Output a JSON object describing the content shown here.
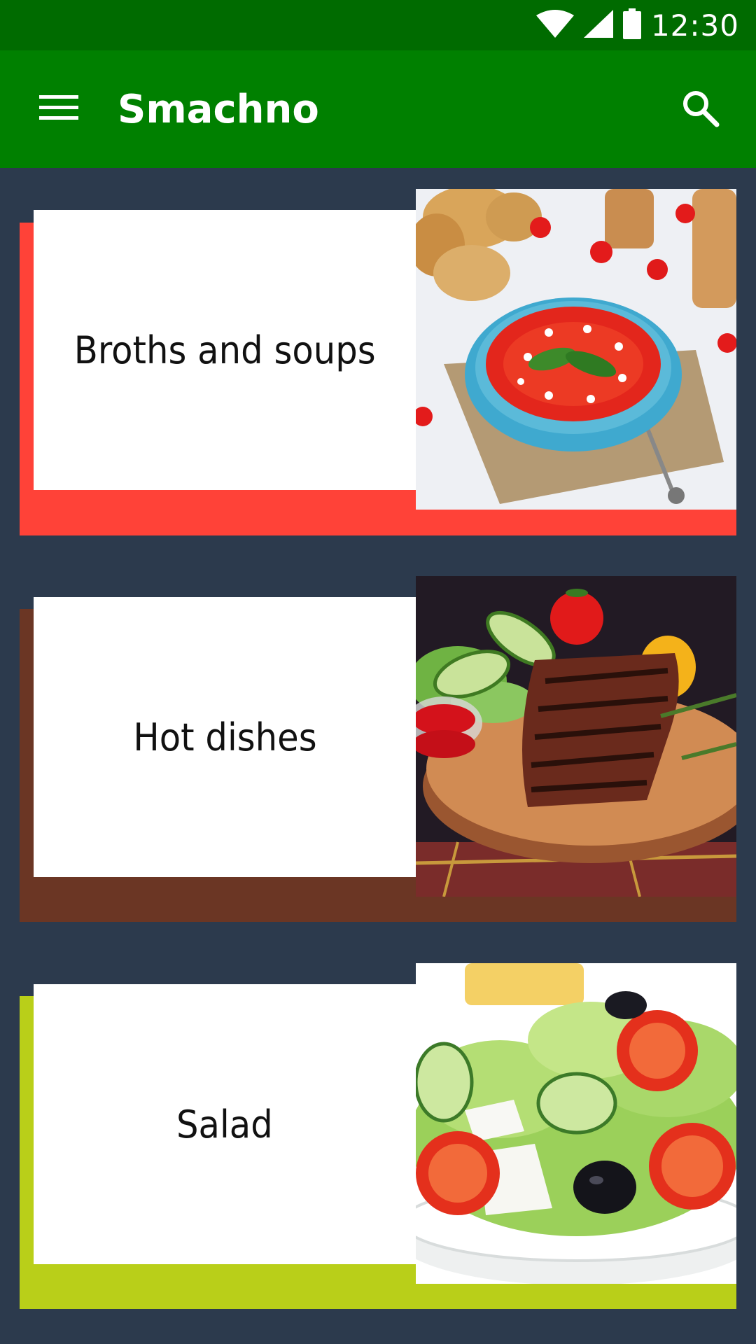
{
  "status_bar": {
    "time": "12:30",
    "icons": [
      "wifi-icon",
      "cell-signal-icon",
      "battery-icon"
    ]
  },
  "app_bar": {
    "title": "Smachno",
    "menu_icon": "hamburger-menu-icon",
    "search_icon": "search-icon",
    "color": "#008000",
    "status_color": "#006b00"
  },
  "background_color": "#2c3a4d",
  "categories": [
    {
      "label": "Broths and soups",
      "accent": "#ff4238",
      "image": "tomato-soup-image"
    },
    {
      "label": "Hot dishes",
      "accent": "#6b3624",
      "image": "grilled-steak-image"
    },
    {
      "label": "Salad",
      "accent": "#b9cf19",
      "image": "greek-salad-image"
    }
  ]
}
